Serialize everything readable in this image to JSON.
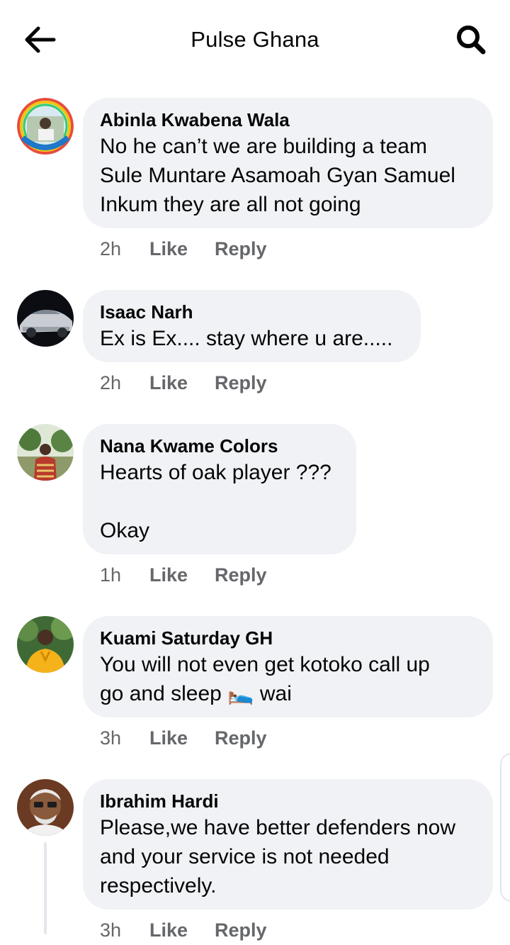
{
  "header": {
    "title": "Pulse Ghana",
    "back_icon": "arrow-left-icon",
    "search_icon": "search-icon"
  },
  "comments": [
    {
      "author": "Abinla Kwabena Wala",
      "text": "No he can’t we are building a team\nSule Muntare Asamoah Gyan Samuel\nInkum they are all not going",
      "time": "2h",
      "like": "Like",
      "reply": "Reply"
    },
    {
      "author": "Isaac Narh",
      "text": "Ex is Ex.... stay where u are.....",
      "time": "2h",
      "like": "Like",
      "reply": "Reply"
    },
    {
      "author": "Nana Kwame Colors",
      "text": "Hearts of oak player ???\n\nOkay",
      "time": "1h",
      "like": "Like",
      "reply": "Reply"
    },
    {
      "author": "Kuami Saturday GH",
      "text_before": "You will not even get kotoko call up\ngo and sleep ",
      "emoji": "🛌",
      "text_after": " wai",
      "time": "3h",
      "like": "Like",
      "reply": "Reply"
    },
    {
      "author": "Ibrahim Hardi",
      "text": "Please,we have better defenders now\nand your service is not needed\nrespectively.",
      "time": "3h",
      "like": "Like",
      "reply": "Reply"
    }
  ],
  "colors": {
    "bubble": "#f0f2f5",
    "meta": "#65676b",
    "text": "#050505"
  }
}
